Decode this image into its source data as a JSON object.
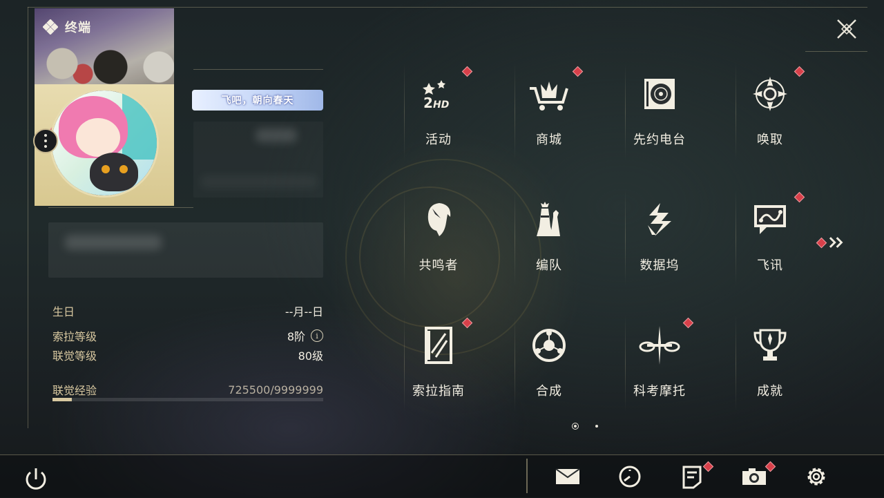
{
  "header": {
    "title": "终端"
  },
  "profile": {
    "nameplate_text": "飞吧，朝向春天",
    "info": [
      {
        "label": "生日",
        "value": "--月--日"
      },
      {
        "label": "索拉等级",
        "value": "8阶"
      },
      {
        "label": "联觉等级",
        "value": "80级"
      },
      {
        "label": "联觉经验",
        "value": "725500/9999999"
      }
    ],
    "exp_progress": 0.0726
  },
  "menu": {
    "items": [
      {
        "label": "活动",
        "icon": "event-2hd-icon",
        "badge": true
      },
      {
        "label": "商城",
        "icon": "shop-cart-crown-icon",
        "badge": true
      },
      {
        "label": "先约电台",
        "icon": "radio-record-icon",
        "badge": false
      },
      {
        "label": "唤取",
        "icon": "convene-star-icon",
        "badge": true
      },
      {
        "label": "共鸣者",
        "icon": "resonator-head-icon",
        "badge": false
      },
      {
        "label": "编队",
        "icon": "team-chess-icon",
        "badge": false
      },
      {
        "label": "数据坞",
        "icon": "data-bank-icon",
        "badge": false
      },
      {
        "label": "飞讯",
        "icon": "message-chat-icon",
        "badge": true
      },
      {
        "label": "索拉指南",
        "icon": "guide-book-icon",
        "badge": true
      },
      {
        "label": "合成",
        "icon": "synthesis-orb-icon",
        "badge": false
      },
      {
        "label": "科考摩托",
        "icon": "motorcycle-icon",
        "badge": true
      },
      {
        "label": "成就",
        "icon": "trophy-icon",
        "badge": false
      }
    ],
    "page_count": 2,
    "active_page": 1
  },
  "bottom_bar": {
    "buttons": [
      {
        "icon": "mail-icon",
        "badge": false
      },
      {
        "icon": "clock-icon",
        "badge": false
      },
      {
        "icon": "notice-icon",
        "badge": true
      },
      {
        "icon": "camera-icon",
        "badge": true
      },
      {
        "icon": "settings-gear-icon",
        "badge": false
      }
    ]
  },
  "colors": {
    "accent_gold": "#d8c8a0",
    "badge_red": "#d8404a",
    "text": "#f2eee2"
  }
}
